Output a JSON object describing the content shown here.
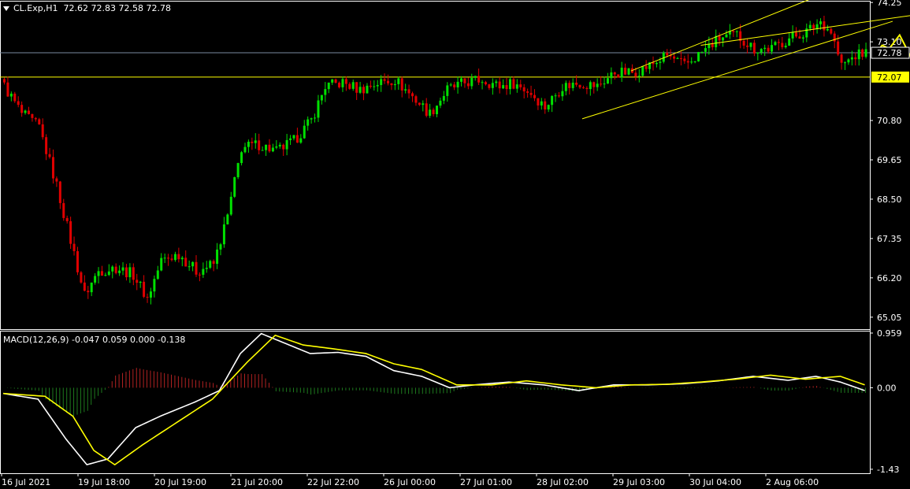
{
  "header": {
    "symbol": "CL.Exp,H1",
    "ohlc": "72.62 72.83 72.58 72.78"
  },
  "macd": {
    "label": "MACD(12,26,9) -0.047 0.059 0.000 -0.138"
  },
  "colors": {
    "background": "#000000",
    "bull": "#00E000",
    "bear": "#E00000",
    "channel": "#FFFF00",
    "macd_line": "#FFFFFF",
    "signal_line": "#FFFF00",
    "hist_pos": "#B22222",
    "hist_neg": "#1E7A1E",
    "axis_text": "#FFFFFF"
  },
  "chart_data": [
    {
      "type": "candlestick",
      "price_axis_ticks": [
        "74.25",
        "73.10",
        "70.80",
        "69.65",
        "68.50",
        "67.35",
        "66.20",
        "65.05"
      ],
      "ylim": [
        64.7,
        74.3
      ],
      "current_price": "72.78",
      "level_label": "72.07",
      "time_labels": [
        "16 Jul 2021",
        "19 Jul 18:00",
        "20 Jul 19:00",
        "21 Jul 20:00",
        "22 Jul 22:00",
        "26 Jul 00:00",
        "27 Jul 01:00",
        "28 Jul 02:00",
        "29 Jul 03:00",
        "30 Jul 04:00",
        "2 Aug 06:00"
      ],
      "close_anchors": [
        [
          0,
          71.8
        ],
        [
          5,
          71.0
        ],
        [
          10,
          70.6
        ],
        [
          15,
          68.9
        ],
        [
          20,
          66.9
        ],
        [
          23,
          65.7
        ],
        [
          27,
          66.4
        ],
        [
          32,
          66.5
        ],
        [
          37,
          66.3
        ],
        [
          41,
          65.6
        ],
        [
          45,
          66.7
        ],
        [
          50,
          66.9
        ],
        [
          55,
          66.4
        ],
        [
          60,
          66.6
        ],
        [
          64,
          68.0
        ],
        [
          68,
          70.0
        ],
        [
          73,
          70.1
        ],
        [
          78,
          69.9
        ],
        [
          83,
          70.2
        ],
        [
          88,
          70.8
        ],
        [
          92,
          71.8
        ],
        [
          97,
          71.9
        ],
        [
          102,
          71.7
        ],
        [
          107,
          71.9
        ],
        [
          112,
          72.0
        ],
        [
          117,
          71.5
        ],
        [
          122,
          71.0
        ],
        [
          127,
          71.7
        ],
        [
          132,
          71.9
        ],
        [
          137,
          72.0
        ],
        [
          142,
          71.8
        ],
        [
          146,
          71.9
        ],
        [
          151,
          71.6
        ],
        [
          155,
          71.2
        ],
        [
          160,
          71.8
        ],
        [
          165,
          71.9
        ],
        [
          170,
          71.8
        ],
        [
          175,
          72.2
        ],
        [
          180,
          72.2
        ],
        [
          185,
          72.4
        ],
        [
          190,
          72.7
        ],
        [
          195,
          72.4
        ],
        [
          200,
          72.8
        ],
        [
          205,
          73.2
        ],
        [
          210,
          73.3
        ],
        [
          215,
          72.9
        ],
        [
          220,
          72.9
        ],
        [
          225,
          73.2
        ],
        [
          230,
          73.4
        ],
        [
          234,
          73.7
        ],
        [
          237,
          73.4
        ],
        [
          240,
          72.4
        ],
        [
          244,
          72.7
        ],
        [
          247,
          72.78
        ]
      ],
      "macd_axis_ticks": [
        "0.959",
        "0.00",
        "-1.43"
      ],
      "macd_ylim": [
        -1.5,
        1.0
      ],
      "macd_anchors": [
        [
          0,
          -0.1
        ],
        [
          10,
          -0.2
        ],
        [
          18,
          -0.9
        ],
        [
          24,
          -1.35
        ],
        [
          30,
          -1.25
        ],
        [
          38,
          -0.7
        ],
        [
          45,
          -0.5
        ],
        [
          55,
          -0.25
        ],
        [
          62,
          -0.05
        ],
        [
          68,
          0.6
        ],
        [
          74,
          0.95
        ],
        [
          80,
          0.8
        ],
        [
          88,
          0.6
        ],
        [
          96,
          0.62
        ],
        [
          104,
          0.55
        ],
        [
          112,
          0.3
        ],
        [
          120,
          0.2
        ],
        [
          128,
          0.0
        ],
        [
          135,
          0.05
        ],
        [
          145,
          0.1
        ],
        [
          155,
          0.05
        ],
        [
          165,
          -0.05
        ],
        [
          175,
          0.05
        ],
        [
          185,
          0.05
        ],
        [
          195,
          0.07
        ],
        [
          205,
          0.12
        ],
        [
          215,
          0.2
        ],
        [
          225,
          0.13
        ],
        [
          233,
          0.2
        ],
        [
          240,
          0.1
        ],
        [
          247,
          -0.05
        ]
      ],
      "signal_anchors": [
        [
          0,
          -0.1
        ],
        [
          12,
          -0.15
        ],
        [
          20,
          -0.5
        ],
        [
          26,
          -1.1
        ],
        [
          32,
          -1.35
        ],
        [
          40,
          -1.0
        ],
        [
          50,
          -0.6
        ],
        [
          60,
          -0.2
        ],
        [
          70,
          0.45
        ],
        [
          78,
          0.92
        ],
        [
          86,
          0.75
        ],
        [
          95,
          0.68
        ],
        [
          104,
          0.6
        ],
        [
          112,
          0.42
        ],
        [
          120,
          0.32
        ],
        [
          130,
          0.05
        ],
        [
          140,
          0.05
        ],
        [
          150,
          0.12
        ],
        [
          160,
          0.05
        ],
        [
          170,
          0.0
        ],
        [
          180,
          0.05
        ],
        [
          190,
          0.06
        ],
        [
          200,
          0.1
        ],
        [
          210,
          0.15
        ],
        [
          220,
          0.22
        ],
        [
          230,
          0.15
        ],
        [
          240,
          0.2
        ],
        [
          247,
          0.05
        ]
      ]
    }
  ]
}
